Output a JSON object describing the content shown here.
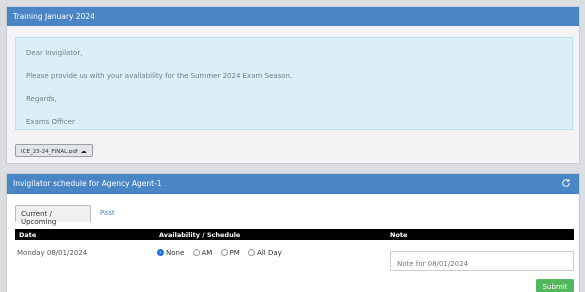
{
  "training_panel": {
    "title": "Training January 2024",
    "message": {
      "greeting": "Dear Invigilator,",
      "body": "Please provide us with your availability for the Summer 2024 Exam Season.",
      "closing": "Regards,",
      "signature": "Exams Officer"
    },
    "attachment": {
      "filename": "ICE_23-24_FINAL.pdf",
      "icon": "cloud-download-icon"
    }
  },
  "schedule_panel": {
    "title": "Invigilator schedule for Agency Agent-1",
    "refresh_icon": "refresh-icon",
    "tabs": [
      {
        "label": "Current / Upcoming",
        "active": true
      },
      {
        "label": "Past",
        "active": false
      }
    ],
    "columns": [
      "Date",
      "Availability / Schedule",
      "Note"
    ],
    "rows": [
      {
        "date": "Monday 08/01/2024",
        "options": [
          {
            "label": "None",
            "selected": true
          },
          {
            "label": "AM",
            "selected": false
          },
          {
            "label": "PM",
            "selected": false
          },
          {
            "label": "All Day",
            "selected": false
          }
        ],
        "note_placeholder": "Note for 08/01/2024"
      }
    ],
    "submit_label": "Submit"
  },
  "colors": {
    "header": "#4a86c5",
    "alert_bg": "#dbeff8",
    "submit": "#53b85b",
    "table_head": "#000000"
  }
}
